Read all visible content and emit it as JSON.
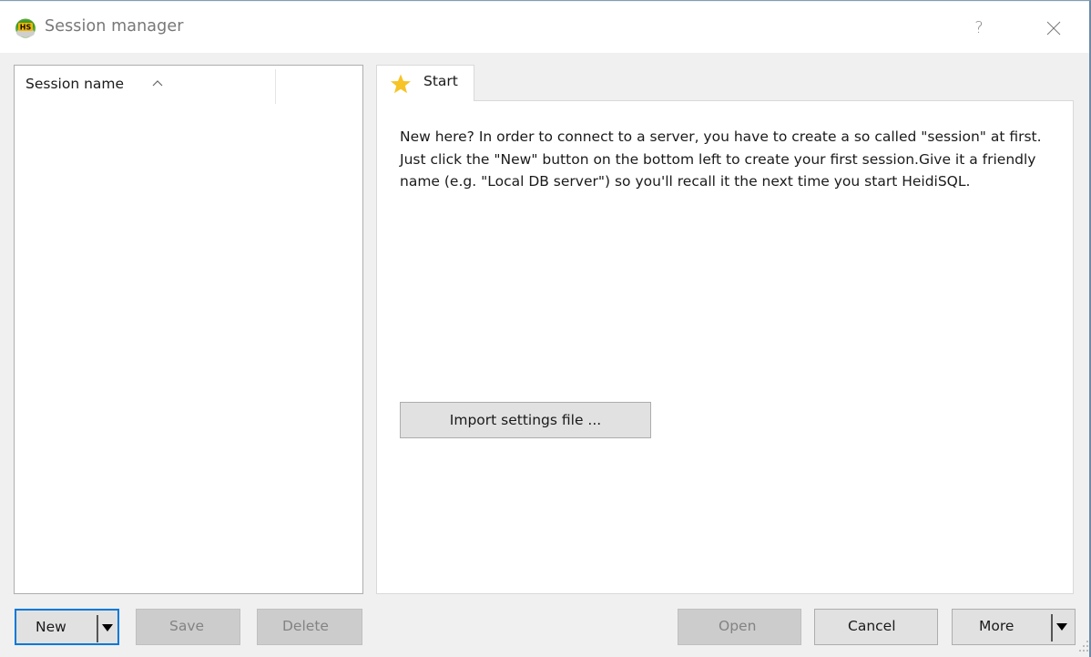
{
  "window": {
    "title": "Session manager",
    "app_icon": "heidisql-hs-icon",
    "help_label": "?",
    "close_icon": "close-icon"
  },
  "session_list": {
    "columns": [
      {
        "label": "Session name",
        "sort": "ascending"
      },
      {
        "label": ""
      }
    ],
    "items": []
  },
  "tabs": [
    {
      "label": "Start",
      "icon": "star-icon",
      "active": true
    }
  ],
  "start_tab": {
    "intro_text": "New here? In order to connect to a server, you have to create a so called \"session\" at first. Just click the \"New\" button on the bottom left to create your first session.Give it a friendly name (e.g. \"Local DB server\") so you'll recall it the next time you start HeidiSQL.",
    "import_button": "Import settings file ..."
  },
  "buttons": {
    "new": {
      "label": "New",
      "enabled": true,
      "has_dropdown": true
    },
    "save": {
      "label": "Save",
      "enabled": false
    },
    "delete": {
      "label": "Delete",
      "enabled": false
    },
    "open": {
      "label": "Open",
      "enabled": false
    },
    "cancel": {
      "label": "Cancel",
      "enabled": true
    },
    "more": {
      "label": "More",
      "enabled": true,
      "has_dropdown": true
    }
  },
  "colors": {
    "focus_accent": "#0078d7",
    "star": "#f7c325",
    "app_icon_green": "#4caf50",
    "app_icon_badge": "#f0b400"
  }
}
